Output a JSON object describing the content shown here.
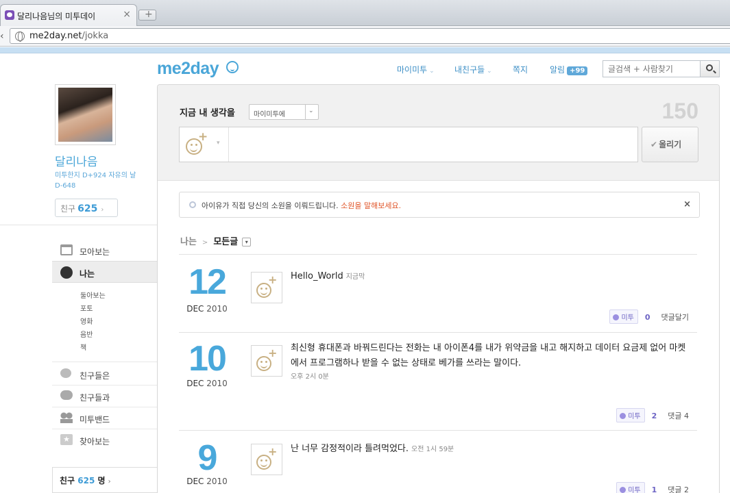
{
  "browser": {
    "tab_title": "달리나음님의 미투데이",
    "tab_close": "×",
    "newtab_label": "+",
    "url_domain": "me2day.net",
    "url_path": "/jokka"
  },
  "header": {
    "logo": "me2day",
    "nav": [
      {
        "label": "마이미투",
        "caret": "⌄"
      },
      {
        "label": "내친구들",
        "caret": "⌄"
      },
      {
        "label": "쪽지",
        "caret": ""
      },
      {
        "label": "알림",
        "badge": "+99"
      }
    ],
    "search_placeholder": "글검색 + 사람찾기"
  },
  "profile": {
    "name": "달리나음",
    "meta_line1": "미투한지 D+924 자유의 날",
    "meta_line2": "D-648",
    "friend_label": "친구",
    "friend_count": "625",
    "friend_arrow": "›"
  },
  "sidebar": {
    "items": [
      {
        "label": "모아보는",
        "icon": "calendar-icon"
      },
      {
        "label": "나는",
        "icon": "face-icon"
      },
      {
        "label": "친구들은",
        "icon": "bubbles-icon"
      },
      {
        "label": "친구들과",
        "icon": "chat-icon"
      },
      {
        "label": "미투밴드",
        "icon": "band-icon"
      },
      {
        "label": "찾아보는",
        "icon": "star-icon"
      }
    ],
    "sub_items": [
      "둘아보는",
      "포토",
      "영화",
      "음반",
      "책"
    ],
    "friends_box": {
      "label": "친구",
      "count": "625",
      "suffix": "명",
      "arrow": "›"
    }
  },
  "compose": {
    "label": "지금 내 생각을",
    "select_value": "마이미투에",
    "char_count": "150",
    "post_button": "올리기"
  },
  "notice": {
    "text": "아이유가 직접 당신의 소원을 이뤄드립니다.",
    "link": "소원을 말해보세요.",
    "close": "×"
  },
  "breadcrumb": {
    "parent": "나는",
    "separator": ">",
    "current": "모든글"
  },
  "posts": [
    {
      "day": "12",
      "month": "DEC",
      "year": "2010",
      "text": "Hello_World",
      "time": "지금막",
      "me2_label": "미투",
      "me2_count": "0",
      "reply_label": "댓글달기"
    },
    {
      "day": "10",
      "month": "DEC",
      "year": "2010",
      "text": "최신형 휴대폰과 바꿔드린다는 전화는 내 아이폰4를 내가 위약금을 내고 해지하고 데이터 요금제 없어 마켓에서 프로그램하나 받을 수 없는 상태로 베가를 쓰라는 말이다.",
      "time": "오후 2시 0분",
      "me2_label": "미투",
      "me2_count": "2",
      "reply_label": "댓글 4"
    },
    {
      "day": "9",
      "month": "DEC",
      "year": "2010",
      "text": "난 너무 감정적이라 틀려먹었다.",
      "time": "오전 1시 59분",
      "me2_label": "미투",
      "me2_count": "1",
      "reply_label": "댓글 2"
    }
  ]
}
